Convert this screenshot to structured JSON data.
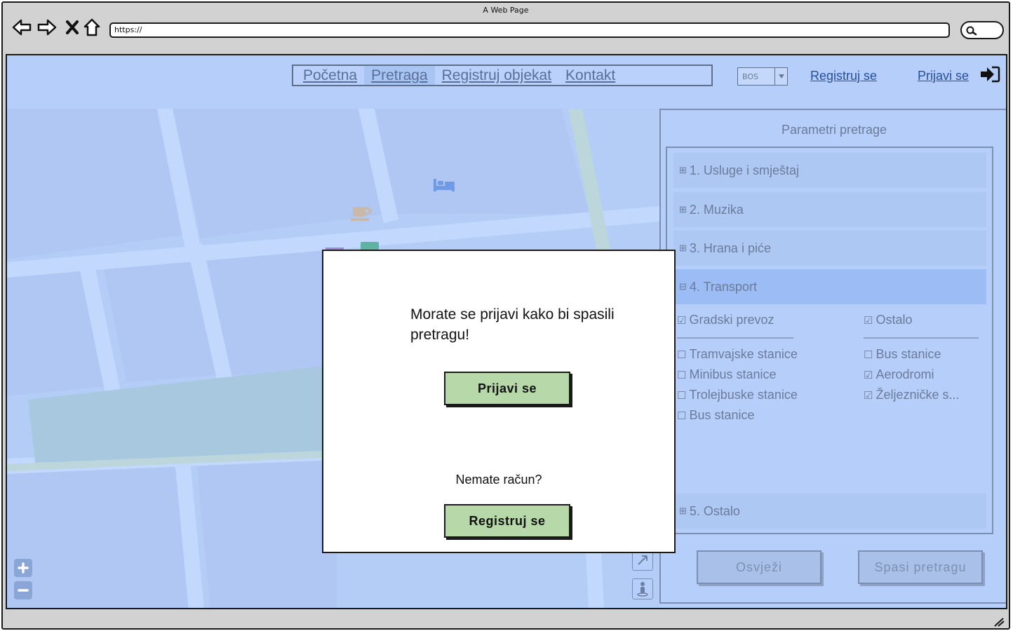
{
  "window": {
    "title": "A Web Page",
    "url": "https://"
  },
  "nav": {
    "items": [
      {
        "label": "Početna",
        "active": false
      },
      {
        "label": "Pretraga",
        "active": true
      },
      {
        "label": "Registruj objekat",
        "active": false
      },
      {
        "label": "Kontakt",
        "active": false
      }
    ]
  },
  "header": {
    "language": "BOS",
    "register_label": "Registruj se",
    "login_label": "Prijavi se"
  },
  "map": {
    "pois": [
      {
        "icon": "bed-icon"
      },
      {
        "icon": "coffee-icon"
      }
    ]
  },
  "panel": {
    "title": "Parametri pretrage",
    "sections": [
      {
        "label": "1. Usluge i smještaj",
        "expanded": false
      },
      {
        "label": "2. Muzika",
        "expanded": false
      },
      {
        "label": "3. Hrana i piće",
        "expanded": false
      },
      {
        "label": "4. Transport",
        "expanded": true
      },
      {
        "label": "5. Ostalo",
        "expanded": false
      }
    ],
    "transport": {
      "groups": [
        {
          "label": "Gradski prevoz",
          "checked": true,
          "items": [
            {
              "label": "Tramvajske stanice",
              "checked": false
            },
            {
              "label": "Minibus stanice",
              "checked": false
            },
            {
              "label": "Trolejbuske stanice",
              "checked": false
            },
            {
              "label": "Bus stanice",
              "checked": false
            }
          ]
        },
        {
          "label": "Ostalo",
          "checked": true,
          "items": [
            {
              "label": "Bus stanice",
              "checked": false
            },
            {
              "label": "Aerodromi",
              "checked": true
            },
            {
              "label": "Željezničke s...",
              "checked": true
            }
          ]
        }
      ]
    },
    "refresh_label": "Osvježi",
    "save_label": "Spasi pretragu"
  },
  "modal": {
    "message": "Morate se prijavi kako bi spasili pretragu!",
    "login_button": "Prijavi se",
    "question": "Nemate račun?",
    "register_button": "Registruj se"
  },
  "colors": {
    "page_bg": "#b6cffa",
    "modal_button": "#b7d8a8",
    "link": "#274fa0",
    "muted_text": "#6b7b99"
  }
}
